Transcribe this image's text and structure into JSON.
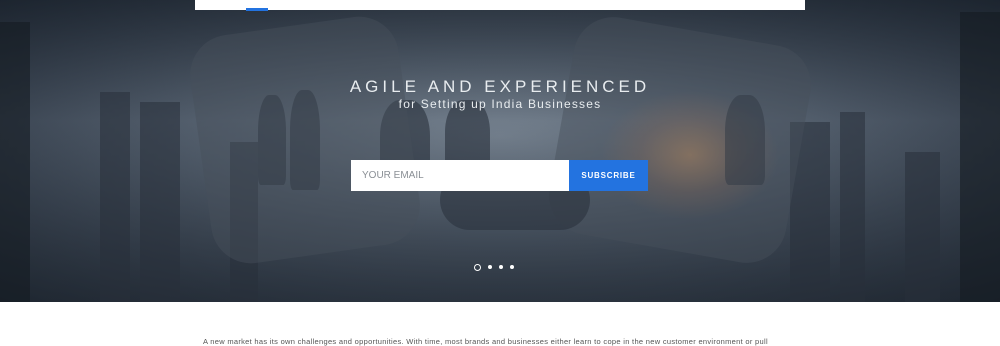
{
  "hero": {
    "title": "AGILE AND EXPERIENCED",
    "subtitle": "for Setting up India Businesses",
    "accent_color": "#2373e0"
  },
  "subscribe": {
    "placeholder": "YOUR EMAIL",
    "value": "",
    "button_label": "SUBSCRIBE"
  },
  "carousel": {
    "total_slides": 4,
    "active_index": 0
  },
  "intro": {
    "text": "A new market has its own challenges and opportunities. With time, most brands and businesses either learn to cope in the new customer environment or pull"
  }
}
